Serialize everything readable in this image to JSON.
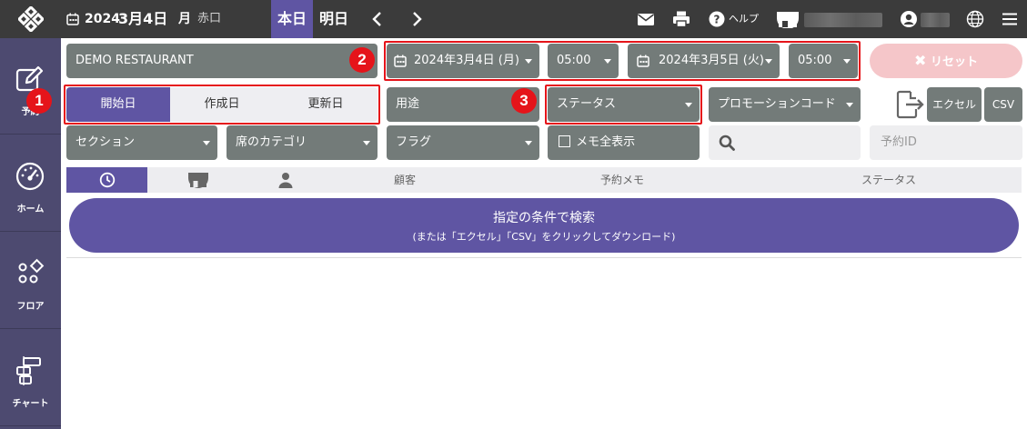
{
  "topbar": {
    "date_year": "2024",
    "date_md": "3月4日",
    "weekday": "月",
    "rokuyo": "赤口",
    "today_label": "本日",
    "tomorrow_label": "明日",
    "prev_symbol": "‹",
    "next_symbol": "›",
    "help_label": "ヘルプ"
  },
  "sidebar": {
    "items": [
      {
        "label": "予約",
        "icon": "edit-icon"
      },
      {
        "label": "ホーム",
        "icon": "dashboard-icon"
      },
      {
        "label": "フロア",
        "icon": "floor-icon"
      },
      {
        "label": "チャート",
        "icon": "chart-icon"
      }
    ]
  },
  "filters": {
    "restaurant": "DEMO RESTAURANT",
    "date_type_tabs": [
      {
        "label": "開始日",
        "active": true
      },
      {
        "label": "作成日",
        "active": false
      },
      {
        "label": "更新日",
        "active": false
      }
    ],
    "start_date": "2024年3月4日 (月)",
    "start_time": "05:00",
    "end_date": "2024年3月5日 (火)",
    "end_time": "05:00",
    "reset_label": "リセット",
    "purpose": "用途",
    "status": "ステータス",
    "promo_code": "プロモーションコード",
    "excel_label": "エクセル",
    "csv_label": "CSV",
    "section": "セクション",
    "seat_category": "席のカテゴリ",
    "flag": "フラグ",
    "show_all_memo": "メモ全表示",
    "reservation_id_placeholder": "予約ID"
  },
  "table": {
    "headers": [
      "顧客",
      "予約メモ",
      "ステータス"
    ]
  },
  "search_button": {
    "line1": "指定の条件で検索",
    "line2": "(または「エクセル」「CSV」をクリックしてダウンロード)"
  },
  "badges": [
    "1",
    "2",
    "3"
  ],
  "colors": {
    "accent": "#5f55a3",
    "control": "#737b79",
    "sidebar": "#4d4a70",
    "topbar": "#3b3b3b",
    "highlight": "#e5141a",
    "reset_bg": "#f5c6c9"
  }
}
